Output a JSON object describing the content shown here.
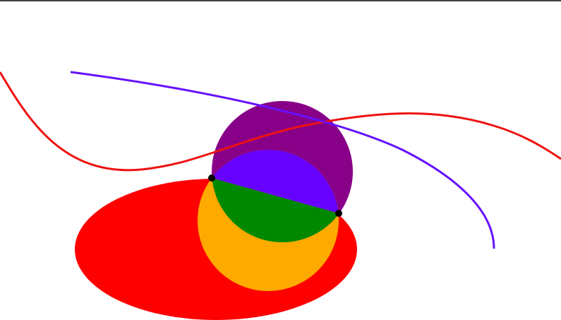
{
  "figure": {
    "background": "#ffffff",
    "top_rule_color": "#000000"
  },
  "colors": {
    "ellipse": "#ff0000",
    "circle_large": "#880088",
    "circle_lower": "#ffaa00",
    "lens_upper": "#6600ff",
    "lens_lower": "#008800",
    "curve_red": "#ee1111",
    "curve_blue": "#6611ff",
    "intersection_points": "#000000"
  },
  "elements": {
    "curves": [
      "red-curve",
      "blue-curve"
    ],
    "shapes": [
      "red-ellipse",
      "purple-circle",
      "orange-circle",
      "blue-lens-segment",
      "green-lens-segment"
    ],
    "points": [
      "intersection-point-left",
      "intersection-point-right"
    ]
  }
}
